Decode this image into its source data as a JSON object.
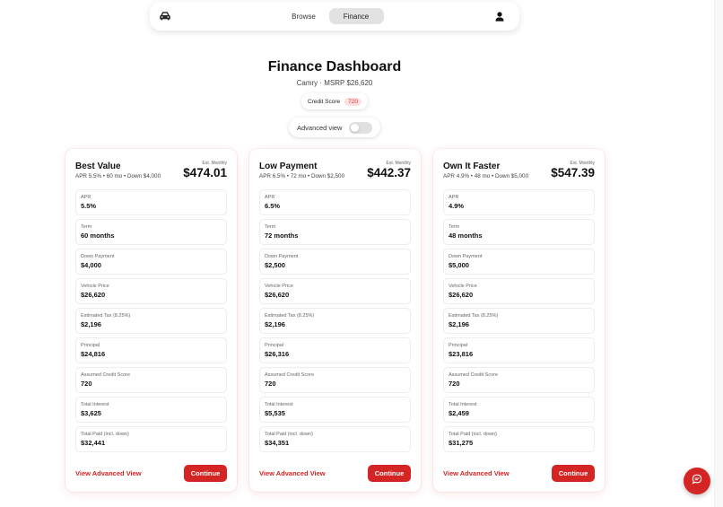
{
  "nav": {
    "tabs": [
      {
        "label": "Browse",
        "active": false
      },
      {
        "label": "Finance",
        "active": true
      }
    ],
    "left_icon": "car-icon",
    "right_icon": "user-icon"
  },
  "header": {
    "title": "Finance Dashboard",
    "subtitle": "Camry · MSRP $26,620",
    "credit_label": "Credit Score",
    "credit_value": "720",
    "advanced_label": "Advanced view",
    "advanced_on": false
  },
  "colors": {
    "accent": "#d42424",
    "badge_bg": "#fde0e0"
  },
  "cards": [
    {
      "name": "Best Value",
      "terms": "APR 5.5% • 60 mo • Down $4,000",
      "est_label": "Est. Monthly",
      "monthly": "$474.01",
      "fields": [
        {
          "label": "APR",
          "value": "5.5%"
        },
        {
          "label": "Term",
          "value": "60 months"
        },
        {
          "label": "Down Payment",
          "value": "$4,000"
        },
        {
          "label": "Vehicle Price",
          "value": "$26,620"
        },
        {
          "label": "Estimated Tax (8.25%)",
          "value": "$2,196"
        },
        {
          "label": "Principal",
          "value": "$24,816"
        },
        {
          "label": "Assumed Credit Score",
          "value": "720"
        },
        {
          "label": "Total Interest",
          "value": "$3,625"
        },
        {
          "label": "Total Paid (incl. down)",
          "value": "$32,441"
        }
      ],
      "link": "View Advanced View",
      "button": "Continue"
    },
    {
      "name": "Low Payment",
      "terms": "APR 6.5% • 72 mo • Down $2,500",
      "est_label": "Est. Monthly",
      "monthly": "$442.37",
      "fields": [
        {
          "label": "APR",
          "value": "6.5%"
        },
        {
          "label": "Term",
          "value": "72 months"
        },
        {
          "label": "Down Payment",
          "value": "$2,500"
        },
        {
          "label": "Vehicle Price",
          "value": "$26,620"
        },
        {
          "label": "Estimated Tax (8.25%)",
          "value": "$2,196"
        },
        {
          "label": "Principal",
          "value": "$26,316"
        },
        {
          "label": "Assumed Credit Score",
          "value": "720"
        },
        {
          "label": "Total Interest",
          "value": "$5,535"
        },
        {
          "label": "Total Paid (incl. down)",
          "value": "$34,351"
        }
      ],
      "link": "View Advanced View",
      "button": "Continue"
    },
    {
      "name": "Own It Faster",
      "terms": "APR 4.9% • 48 mo • Down $5,000",
      "est_label": "Est. Monthly",
      "monthly": "$547.39",
      "fields": [
        {
          "label": "APR",
          "value": "4.9%"
        },
        {
          "label": "Term",
          "value": "48 months"
        },
        {
          "label": "Down Payment",
          "value": "$5,000"
        },
        {
          "label": "Vehicle Price",
          "value": "$26,620"
        },
        {
          "label": "Estimated Tax (8.25%)",
          "value": "$2,196"
        },
        {
          "label": "Principal",
          "value": "$23,816"
        },
        {
          "label": "Assumed Credit Score",
          "value": "720"
        },
        {
          "label": "Total Interest",
          "value": "$2,459"
        },
        {
          "label": "Total Paid (incl. down)",
          "value": "$31,275"
        }
      ],
      "link": "View Advanced View",
      "button": "Continue"
    }
  ],
  "chat_icon": "chat-bubble-icon"
}
